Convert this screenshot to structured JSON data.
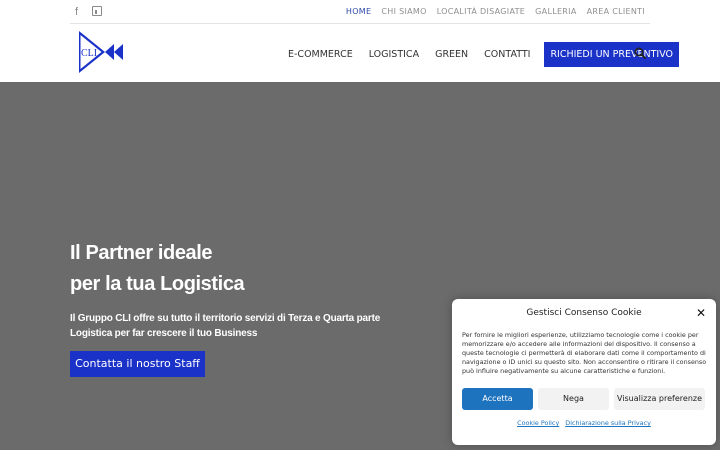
{
  "topbar": {
    "social": [
      {
        "icon": "facebook-icon",
        "glyph": "f"
      },
      {
        "icon": "linkedin-icon",
        "glyph": ""
      }
    ],
    "links": [
      {
        "label": "HOME",
        "active": true
      },
      {
        "label": "CHI SIAMO",
        "active": false
      },
      {
        "label": "LOCALITÀ DISAGIATE",
        "active": false
      },
      {
        "label": "GALLERIA",
        "active": false
      },
      {
        "label": "AREA CLIENTI",
        "active": false
      }
    ]
  },
  "header": {
    "logo_text": "CLI",
    "nav": [
      "E-COMMERCE",
      "LOGISTICA",
      "GREEN",
      "CONTATTI"
    ],
    "cta": "RICHIEDI UN PREVENTIVO",
    "search_icon": "search-icon"
  },
  "hero": {
    "title_line1": "Il Partner ideale",
    "title_line2": "per la tua Logistica",
    "sub_line1": "Il Gruppo CLI offre su tutto il territorio servizi di Terza e Quarta parte",
    "sub_line2": "Logistica per far crescere il tuo Business",
    "button": "Contatta il nostro Staff"
  },
  "cookie": {
    "title": "Gestisci Consenso Cookie",
    "close": "✕",
    "text": "Per fornire le migliori esperienze, utilizziamo tecnologie come i cookie per memorizzare e/o accedere alle informazioni del dispositivo. Il consenso a queste tecnologie ci permetterà di elaborare dati come il comportamento di navigazione o ID unici su questo sito. Non acconsentire o ritirare il consenso può influire negativamente su alcune caratteristiche e funzioni.",
    "accept": "Accetta",
    "deny": "Nega",
    "prefs": "Visualizza preferenze",
    "link1": "Cookie Policy",
    "link2": "Dichiarazione sulla Privacy"
  },
  "colors": {
    "brand_blue": "#1b32c9",
    "hero_gray": "#6b6b6b",
    "cookie_blue": "#1e73be"
  }
}
